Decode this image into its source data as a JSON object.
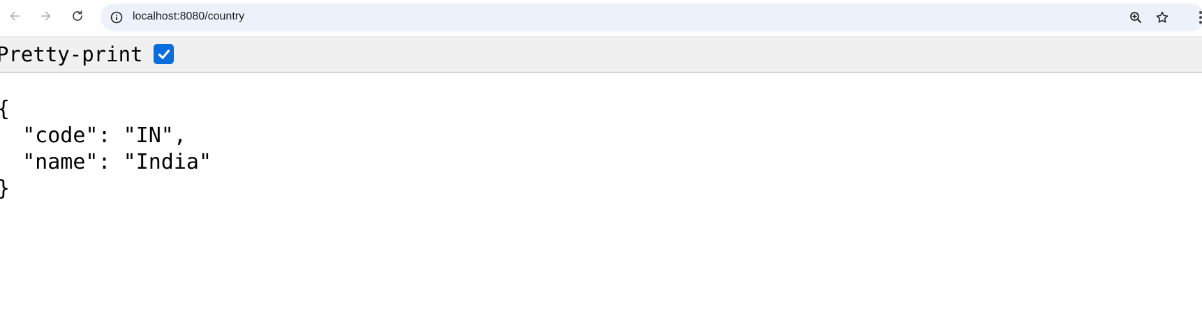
{
  "browser": {
    "url": "localhost:8080/country",
    "icons": {
      "back": "arrow-left-icon",
      "forward": "arrow-right-icon",
      "reload": "reload-icon",
      "site_info": "info-icon",
      "zoom": "zoom-in-icon",
      "bookmark": "star-icon"
    }
  },
  "viewer": {
    "pretty_print_label": "Pretty-print",
    "pretty_print_checked": true
  },
  "json_lines": {
    "open": "{",
    "line1": "  \"code\": \"IN\",",
    "line2": "  \"name\": \"India\"",
    "close": "}"
  },
  "colors": {
    "omnibox_bg": "#edf2fa",
    "checkbox": "#0b6cdc",
    "bar_bg": "#f0f0f0"
  }
}
